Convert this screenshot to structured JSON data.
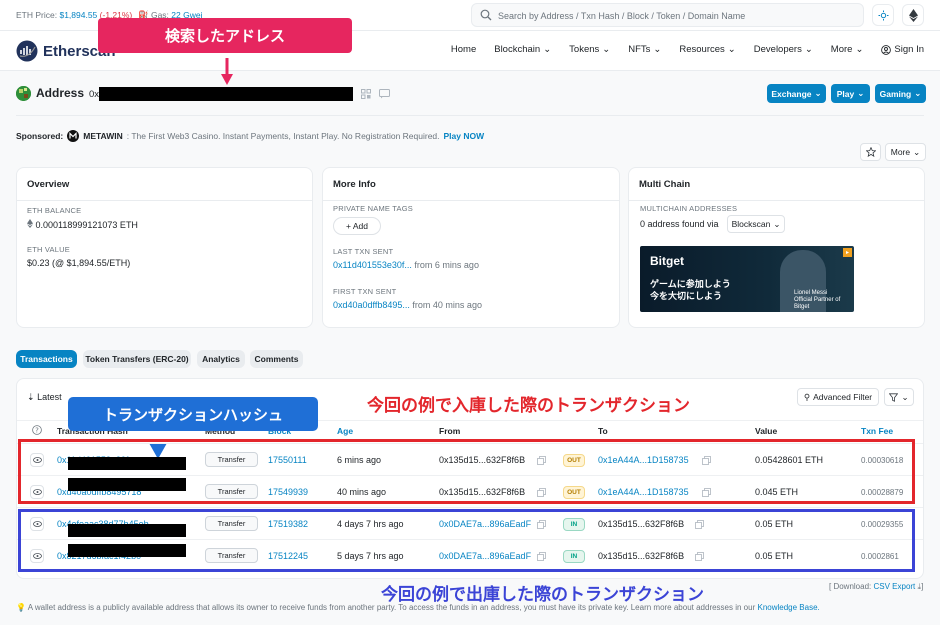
{
  "topbar": {
    "eth_price_label": "ETH Price:",
    "eth_price": "$1,894.55",
    "eth_change": "(-1.21%)",
    "gas_label": "Gas:",
    "gas_value": "22 Gwei",
    "search_placeholder": "Search by Address / Txn Hash / Block / Token / Domain Name"
  },
  "nav": {
    "logo": "Etherscan",
    "items": [
      "Home",
      "Blockchain",
      "Tokens",
      "NFTs",
      "Resources",
      "Developers",
      "More"
    ],
    "sign_in": "Sign In"
  },
  "annotations": {
    "search_address": "検索したアドレス",
    "tx_hash": "トランザクションハッシュ",
    "incoming": "今回の例で入庫した際のトランザクション",
    "outgoing": "今回の例で出庫した際のトランザクション"
  },
  "address": {
    "title": "Address",
    "prefix": "0x"
  },
  "header_buttons": {
    "exchange": "Exchange",
    "play": "Play",
    "gaming": "Gaming"
  },
  "sponsored": {
    "label": "Sponsored:",
    "brand": "METAWIN",
    "text": ": The First Web3 Casino. Instant Payments, Instant Play. No Registration Required.",
    "cta": "Play NOW",
    "more": "More"
  },
  "overview": {
    "title": "Overview",
    "eth_balance_label": "ETH BALANCE",
    "eth_balance": "0.000118999121073 ETH",
    "eth_value_label": "ETH VALUE",
    "eth_value": "$0.23 (@ $1,894.55/ETH)"
  },
  "more_info": {
    "title": "More Info",
    "private_tags_label": "PRIVATE NAME TAGS",
    "add": "+ Add",
    "last_txn_label": "LAST TXN SENT",
    "last_txn_hash": "0x11d401553e30f...",
    "last_txn_time": "from 6 mins ago",
    "first_txn_label": "FIRST TXN SENT",
    "first_txn_hash": "0xd40a0dffb8495...",
    "first_txn_time": "from 40 mins ago"
  },
  "multichain": {
    "title": "Multi Chain",
    "label": "MULTICHAIN ADDRESSES",
    "found": "0 address found via",
    "via": "Blockscan",
    "ad_brand": "Bitget",
    "ad_jp_1": "ゲームに参加しよう",
    "ad_jp_2": "今を大切にしよう",
    "ad_player": "Lionel Messi",
    "ad_player_sub": "Official Partner of Bitget"
  },
  "tabs": [
    "Transactions",
    "Token Transfers (ERC-20)",
    "Analytics",
    "Comments"
  ],
  "tx_panel": {
    "latest": "Latest",
    "advanced_filter": "Advanced Filter",
    "columns": {
      "hash": "Transaction Hash",
      "method": "Method",
      "block": "Block",
      "age": "Age",
      "from": "From",
      "to": "To",
      "value": "Value",
      "fee": "Txn Fee"
    },
    "rows": [
      {
        "hash": "0x11d401553e30f",
        "method": "Transfer",
        "block": "17550111",
        "age": "6 mins ago",
        "from": "0x135d15...632F8f6B",
        "dir": "OUT",
        "to": "0x1eA44A...1D158735",
        "value": "0.05428601 ETH",
        "fee": "0.00030618"
      },
      {
        "hash": "0xd40a0dffb8495718",
        "method": "Transfer",
        "block": "17549939",
        "age": "40 mins ago",
        "from": "0x135d15...632F8f6B",
        "dir": "OUT",
        "to": "0x1eA44A...1D158735",
        "value": "0.045 ETH",
        "fee": "0.00028879"
      },
      {
        "hash": "0x4efeaac38d77b45eb",
        "method": "Transfer",
        "block": "17519382",
        "age": "4 days 7 hrs ago",
        "from": "0x0DAE7a...896aEadF",
        "dir": "IN",
        "to": "0x135d15...632F8f6B",
        "value": "0.05 ETH",
        "fee": "0.00029355"
      },
      {
        "hash": "0x8217d6bfac1f42b0",
        "method": "Transfer",
        "block": "17512245",
        "age": "5 days 7 hrs ago",
        "from": "0x0DAE7a...896aEadF",
        "dir": "IN",
        "to": "0x135d15...632F8f6B",
        "value": "0.05 ETH",
        "fee": "0.0002861"
      }
    ],
    "csv": "[ Download:",
    "csv_link": "CSV Export",
    "csv_end": "]"
  },
  "footer": {
    "text": "A wallet address is a publicly available address that allows its owner to receive funds from another party. To access the funds in an address, you must have its private key. Learn more about addresses in our",
    "link": "Knowledge Base."
  }
}
